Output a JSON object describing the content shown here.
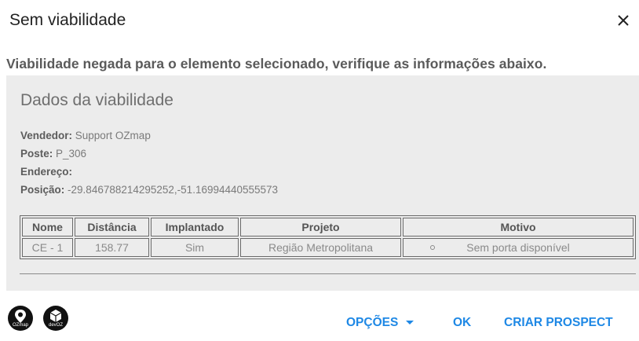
{
  "dialog": {
    "title": "Sem viabilidade",
    "message": "Viabilidade negada para o elemento selecionado, verifique as informações abaixo."
  },
  "panel": {
    "title": "Dados da viabilidade",
    "fields": {
      "vendedor_label": "Vendedor:",
      "vendedor_value": "Support OZmap",
      "poste_label": "Poste:",
      "poste_value": "P_306",
      "endereco_label": "Endereço:",
      "endereco_value": "",
      "posicao_label": "Posição:",
      "posicao_value": "-29.846788214295252,-51.16994440555573"
    }
  },
  "table": {
    "headers": [
      "Nome",
      "Distância",
      "Implantado",
      "Projeto",
      "Motivo"
    ],
    "rows": [
      [
        "CE - 1",
        "158.77",
        "Sim",
        "Região Metropolitana",
        "Sem porta disponível"
      ]
    ]
  },
  "logos": [
    {
      "icon": "ozmap-pin-icon",
      "label": "OZmap"
    },
    {
      "icon": "devoz-cube-icon",
      "label": "devOZ"
    }
  ],
  "actions": {
    "options_label": "OPÇÕES",
    "ok_label": "OK",
    "prospect_label": "CRIAR PROSPECT"
  },
  "colors": {
    "accent": "#1e88e5",
    "panel_bg": "#ececec"
  }
}
